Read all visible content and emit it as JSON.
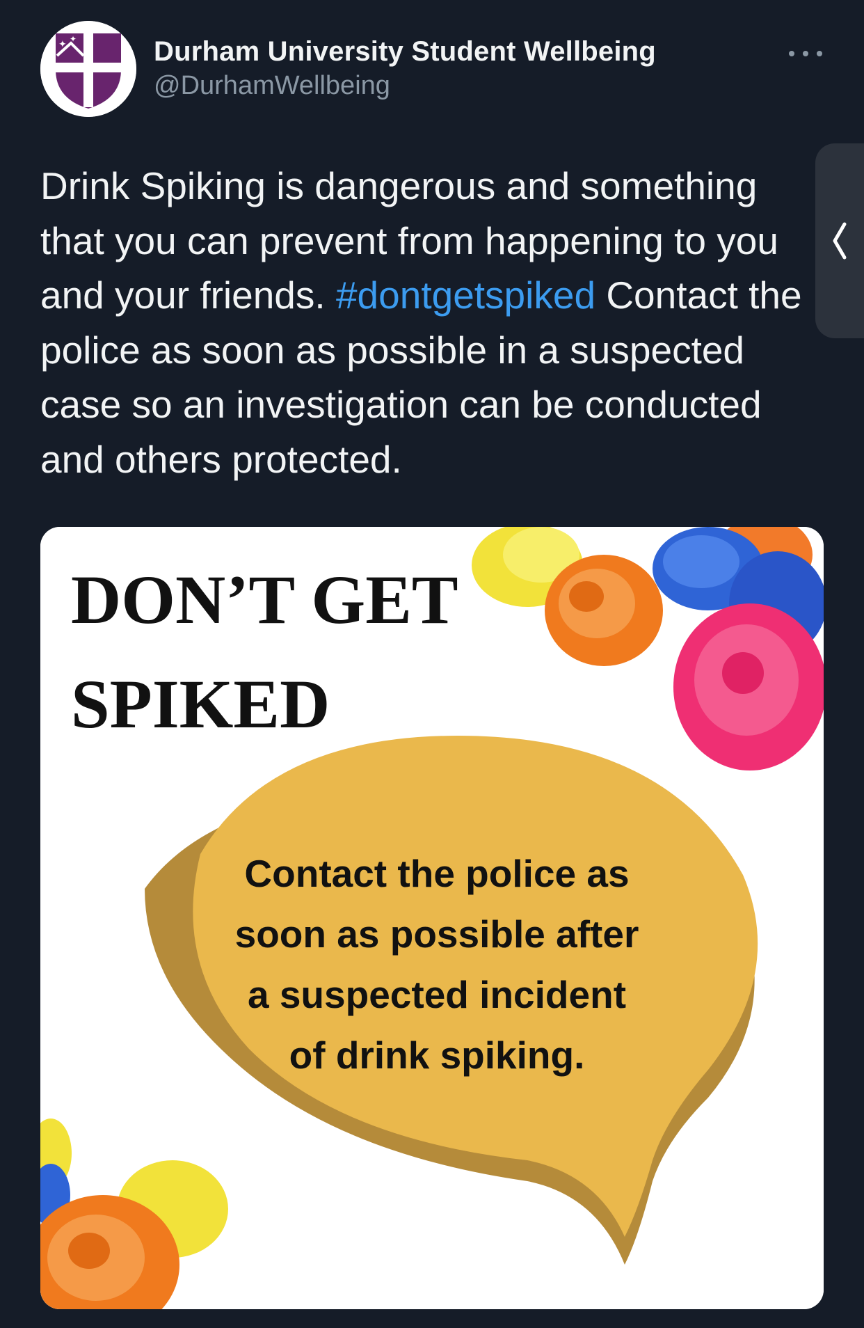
{
  "tweet": {
    "author": {
      "name": "Durham University Student Wellbeing",
      "handle": "@DurhamWellbeing",
      "avatar_icon": "durham-university-crest",
      "avatar_colors": {
        "crest": "#68246d",
        "cross": "#ffffff"
      }
    },
    "more_icon": "more-options-ellipsis-icon",
    "text": {
      "before": "Drink Spiking is dangerous and something that you can prevent from happening to you and your friends. ",
      "hashtag": "#dontgetspiked",
      "after": " Contact the police as soon as possible in a suspected case so an investigation can be conducted and others protected."
    },
    "side_tab_icon": "chevron-left-icon",
    "media": {
      "title": "DON’T GET\nSPIKED",
      "body": "Contact the police as soon as possible after a suspected incident of drink spiking."
    }
  },
  "colors": {
    "background": "#151c28",
    "text": "#f2f4f5",
    "muted": "#8b98a5",
    "link": "#3c9cf0",
    "bubble": "#eab84c",
    "bubble_shadow": "#b58b3a"
  }
}
